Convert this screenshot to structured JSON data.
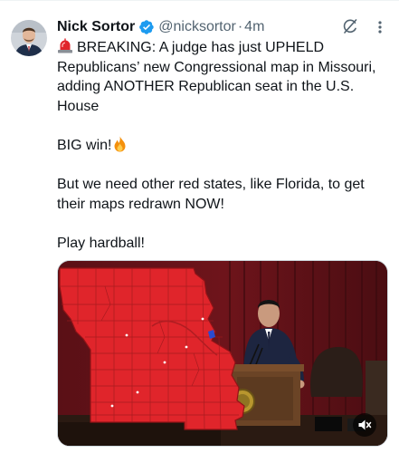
{
  "tweet": {
    "author": {
      "display_name": "Nick Sortor",
      "handle": "@nicksortor",
      "verified": true
    },
    "separator": "·",
    "time": "4m",
    "body": {
      "line1": "BREAKING: A judge has just UPHELD Republicans’ new Congressional map in Missouri, adding ANOTHER Republican seat in the U.S. House",
      "line2": "BIG win!",
      "line3": "But we need other red states, like Florida, to get their maps redrawn NOW!",
      "line4": "Play hardball!"
    },
    "emoji": {
      "siren": "siren-emoji",
      "fire": "fire-emoji"
    },
    "media": {
      "type": "video",
      "muted": true
    }
  },
  "icons": {
    "grok": "grok-icon",
    "more": "more-icon",
    "verified": "verified-badge-icon",
    "mute": "volume-mute-icon"
  },
  "colors": {
    "text_primary": "#0f1419",
    "text_secondary": "#536471",
    "verified_blue": "#1d9bf0",
    "map_red": "#e0252b"
  }
}
